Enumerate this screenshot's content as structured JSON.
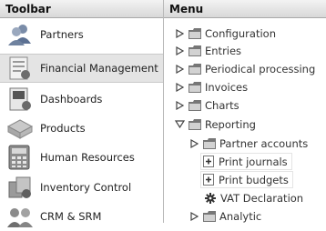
{
  "toolbar": {
    "title": "Toolbar",
    "items": [
      {
        "label": "Partners",
        "icon": "partners-icon"
      },
      {
        "label": "Financial Management",
        "icon": "financial-management-icon",
        "selected": true
      },
      {
        "label": "Dashboards",
        "icon": "dashboards-icon"
      },
      {
        "label": "Products",
        "icon": "products-icon"
      },
      {
        "label": "Human Resources",
        "icon": "human-resources-icon"
      },
      {
        "label": "Inventory Control",
        "icon": "inventory-control-icon"
      },
      {
        "label": "CRM & SRM",
        "icon": "crm-srm-icon"
      }
    ]
  },
  "menu": {
    "title": "Menu",
    "items": [
      {
        "label": "Configuration",
        "state": "collapsed"
      },
      {
        "label": "Entries",
        "state": "collapsed"
      },
      {
        "label": "Periodical processing",
        "state": "collapsed"
      },
      {
        "label": "Invoices",
        "state": "collapsed"
      },
      {
        "label": "Charts",
        "state": "collapsed"
      },
      {
        "label": "Reporting",
        "state": "expanded"
      },
      {
        "label": "Partner accounts",
        "state": "collapsed"
      },
      {
        "label": "Print journals",
        "type": "document"
      },
      {
        "label": "Print budgets",
        "type": "document"
      },
      {
        "label": "VAT Declaration",
        "type": "action"
      },
      {
        "label": "Analytic",
        "state": "collapsed"
      }
    ]
  }
}
